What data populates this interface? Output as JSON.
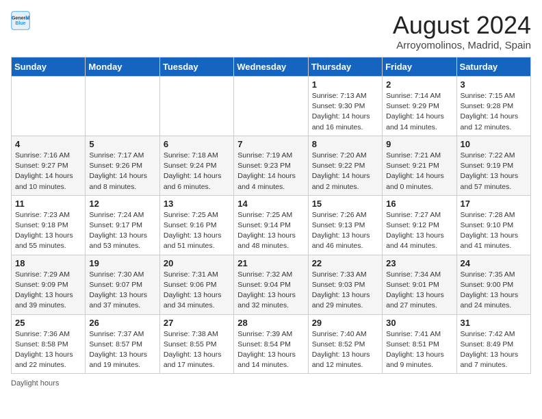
{
  "header": {
    "logo_line1": "General",
    "logo_line2": "Blue",
    "month_year": "August 2024",
    "location": "Arroyomolinos, Madrid, Spain"
  },
  "days_of_week": [
    "Sunday",
    "Monday",
    "Tuesday",
    "Wednesday",
    "Thursday",
    "Friday",
    "Saturday"
  ],
  "weeks": [
    [
      {
        "day": "",
        "info": ""
      },
      {
        "day": "",
        "info": ""
      },
      {
        "day": "",
        "info": ""
      },
      {
        "day": "",
        "info": ""
      },
      {
        "day": "1",
        "info": "Sunrise: 7:13 AM\nSunset: 9:30 PM\nDaylight: 14 hours and 16 minutes."
      },
      {
        "day": "2",
        "info": "Sunrise: 7:14 AM\nSunset: 9:29 PM\nDaylight: 14 hours and 14 minutes."
      },
      {
        "day": "3",
        "info": "Sunrise: 7:15 AM\nSunset: 9:28 PM\nDaylight: 14 hours and 12 minutes."
      }
    ],
    [
      {
        "day": "4",
        "info": "Sunrise: 7:16 AM\nSunset: 9:27 PM\nDaylight: 14 hours and 10 minutes."
      },
      {
        "day": "5",
        "info": "Sunrise: 7:17 AM\nSunset: 9:26 PM\nDaylight: 14 hours and 8 minutes."
      },
      {
        "day": "6",
        "info": "Sunrise: 7:18 AM\nSunset: 9:24 PM\nDaylight: 14 hours and 6 minutes."
      },
      {
        "day": "7",
        "info": "Sunrise: 7:19 AM\nSunset: 9:23 PM\nDaylight: 14 hours and 4 minutes."
      },
      {
        "day": "8",
        "info": "Sunrise: 7:20 AM\nSunset: 9:22 PM\nDaylight: 14 hours and 2 minutes."
      },
      {
        "day": "9",
        "info": "Sunrise: 7:21 AM\nSunset: 9:21 PM\nDaylight: 14 hours and 0 minutes."
      },
      {
        "day": "10",
        "info": "Sunrise: 7:22 AM\nSunset: 9:19 PM\nDaylight: 13 hours and 57 minutes."
      }
    ],
    [
      {
        "day": "11",
        "info": "Sunrise: 7:23 AM\nSunset: 9:18 PM\nDaylight: 13 hours and 55 minutes."
      },
      {
        "day": "12",
        "info": "Sunrise: 7:24 AM\nSunset: 9:17 PM\nDaylight: 13 hours and 53 minutes."
      },
      {
        "day": "13",
        "info": "Sunrise: 7:25 AM\nSunset: 9:16 PM\nDaylight: 13 hours and 51 minutes."
      },
      {
        "day": "14",
        "info": "Sunrise: 7:25 AM\nSunset: 9:14 PM\nDaylight: 13 hours and 48 minutes."
      },
      {
        "day": "15",
        "info": "Sunrise: 7:26 AM\nSunset: 9:13 PM\nDaylight: 13 hours and 46 minutes."
      },
      {
        "day": "16",
        "info": "Sunrise: 7:27 AM\nSunset: 9:12 PM\nDaylight: 13 hours and 44 minutes."
      },
      {
        "day": "17",
        "info": "Sunrise: 7:28 AM\nSunset: 9:10 PM\nDaylight: 13 hours and 41 minutes."
      }
    ],
    [
      {
        "day": "18",
        "info": "Sunrise: 7:29 AM\nSunset: 9:09 PM\nDaylight: 13 hours and 39 minutes."
      },
      {
        "day": "19",
        "info": "Sunrise: 7:30 AM\nSunset: 9:07 PM\nDaylight: 13 hours and 37 minutes."
      },
      {
        "day": "20",
        "info": "Sunrise: 7:31 AM\nSunset: 9:06 PM\nDaylight: 13 hours and 34 minutes."
      },
      {
        "day": "21",
        "info": "Sunrise: 7:32 AM\nSunset: 9:04 PM\nDaylight: 13 hours and 32 minutes."
      },
      {
        "day": "22",
        "info": "Sunrise: 7:33 AM\nSunset: 9:03 PM\nDaylight: 13 hours and 29 minutes."
      },
      {
        "day": "23",
        "info": "Sunrise: 7:34 AM\nSunset: 9:01 PM\nDaylight: 13 hours and 27 minutes."
      },
      {
        "day": "24",
        "info": "Sunrise: 7:35 AM\nSunset: 9:00 PM\nDaylight: 13 hours and 24 minutes."
      }
    ],
    [
      {
        "day": "25",
        "info": "Sunrise: 7:36 AM\nSunset: 8:58 PM\nDaylight: 13 hours and 22 minutes."
      },
      {
        "day": "26",
        "info": "Sunrise: 7:37 AM\nSunset: 8:57 PM\nDaylight: 13 hours and 19 minutes."
      },
      {
        "day": "27",
        "info": "Sunrise: 7:38 AM\nSunset: 8:55 PM\nDaylight: 13 hours and 17 minutes."
      },
      {
        "day": "28",
        "info": "Sunrise: 7:39 AM\nSunset: 8:54 PM\nDaylight: 13 hours and 14 minutes."
      },
      {
        "day": "29",
        "info": "Sunrise: 7:40 AM\nSunset: 8:52 PM\nDaylight: 13 hours and 12 minutes."
      },
      {
        "day": "30",
        "info": "Sunrise: 7:41 AM\nSunset: 8:51 PM\nDaylight: 13 hours and 9 minutes."
      },
      {
        "day": "31",
        "info": "Sunrise: 7:42 AM\nSunset: 8:49 PM\nDaylight: 13 hours and 7 minutes."
      }
    ]
  ],
  "footer": {
    "daylight_label": "Daylight hours"
  }
}
